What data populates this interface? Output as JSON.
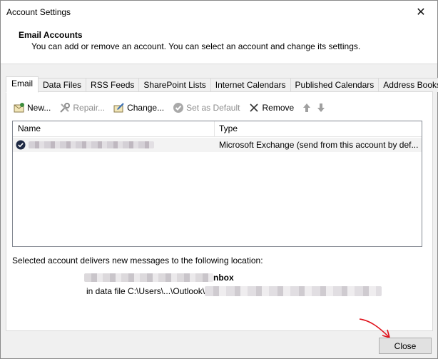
{
  "window": {
    "title": "Account Settings",
    "close_glyph": "✕"
  },
  "header": {
    "title": "Email Accounts",
    "subtitle": "You can add or remove an account. You can select an account and change its settings."
  },
  "tabs": [
    {
      "label": "Email",
      "active": true
    },
    {
      "label": "Data Files"
    },
    {
      "label": "RSS Feeds"
    },
    {
      "label": "SharePoint Lists"
    },
    {
      "label": "Internet Calendars"
    },
    {
      "label": "Published Calendars"
    },
    {
      "label": "Address Books"
    }
  ],
  "toolbar": {
    "new_label": "New...",
    "repair_label": "Repair...",
    "change_label": "Change...",
    "default_label": "Set as Default",
    "remove_label": "Remove"
  },
  "list": {
    "headers": {
      "name": "Name",
      "type": "Type"
    },
    "rows": [
      {
        "type": "Microsoft Exchange (send from this account by def..."
      }
    ]
  },
  "delivery": {
    "label": "Selected account delivers new messages to the following location:",
    "folder_suffix": "nbox",
    "datafile_prefix": "in data file C:\\Users\\...\\Outlook\\"
  },
  "footer": {
    "close_label": "Close"
  },
  "colors": {
    "annotation_arrow": "#e0101a",
    "selection_row": "#f3f3f3"
  }
}
